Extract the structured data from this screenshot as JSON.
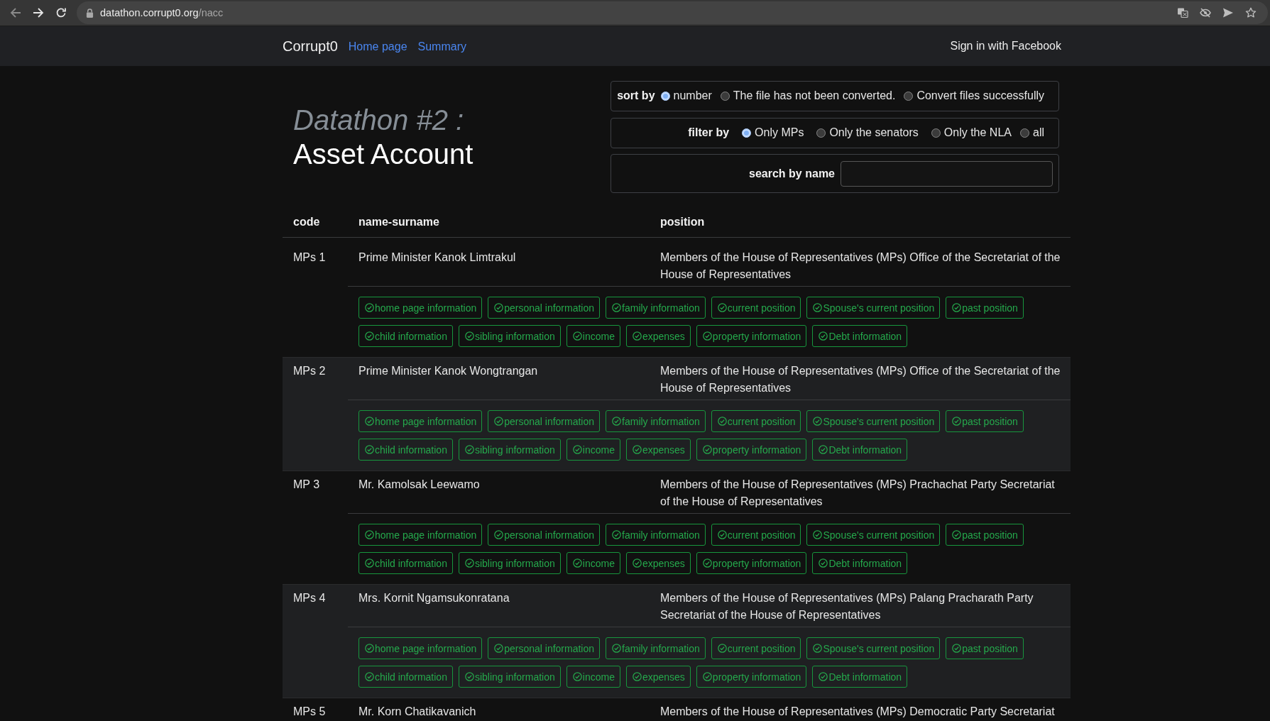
{
  "browser": {
    "back_enabled": false,
    "forward_enabled": true,
    "url_host": "datathon.corrupt0.org",
    "url_path": "/nacc"
  },
  "navbar": {
    "brand": "Corrupt0",
    "links": [
      "Home page",
      "Summary"
    ],
    "sign_in": "Sign in with Facebook"
  },
  "header": {
    "event": "Datathon #2 :",
    "title": "Asset Account"
  },
  "sort_by": {
    "label": "sort by",
    "options": [
      {
        "label": "number",
        "selected": true
      },
      {
        "label": "The file has not been converted.",
        "selected": false
      },
      {
        "label": "Convert files successfully",
        "selected": false
      }
    ]
  },
  "filter_by": {
    "label": "filter by",
    "options": [
      {
        "label": "Only MPs",
        "selected": true
      },
      {
        "label": "Only the senators",
        "selected": false
      },
      {
        "label": "Only the NLA",
        "selected": false
      },
      {
        "label": "all",
        "selected": false
      }
    ]
  },
  "search": {
    "label": "search by name"
  },
  "table": {
    "columns": [
      "code",
      "name-surname",
      "position"
    ],
    "rows": [
      {
        "code": "MPs 1",
        "name": "Prime Minister Kanok Limtrakul",
        "position": "Members of the House of Representatives (MPs) Office of the Secretariat of the House of Representatives",
        "tags": [
          {
            "label": "home page information",
            "checked": true
          },
          {
            "label": "personal information",
            "checked": true
          },
          {
            "label": "family information",
            "checked": true
          },
          {
            "label": "current position",
            "checked": true
          },
          {
            "label": "Spouse's current position",
            "checked": true
          },
          {
            "label": "past position",
            "checked": true
          },
          {
            "label": "child information",
            "checked": true
          },
          {
            "label": "sibling information",
            "checked": true
          },
          {
            "label": "income",
            "checked": true
          },
          {
            "label": "expenses",
            "checked": true
          },
          {
            "label": "property information",
            "checked": true
          },
          {
            "label": "Debt information",
            "checked": true
          }
        ]
      },
      {
        "code": "MPs 2",
        "name": "Prime Minister Kanok Wongtrangan",
        "position": "Members of the House of Representatives (MPs) Office of the Secretariat of the House of Representatives",
        "tags": [
          {
            "label": "home page information",
            "checked": true
          },
          {
            "label": "personal information",
            "checked": true
          },
          {
            "label": "family information",
            "checked": true
          },
          {
            "label": "current position",
            "checked": true
          },
          {
            "label": "Spouse's current position",
            "checked": true
          },
          {
            "label": "past position",
            "checked": true
          },
          {
            "label": "child information",
            "checked": true
          },
          {
            "label": "sibling information",
            "checked": true
          },
          {
            "label": "income",
            "checked": true
          },
          {
            "label": "expenses",
            "checked": true
          },
          {
            "label": "property information",
            "checked": true
          },
          {
            "label": "Debt information",
            "checked": true
          }
        ]
      },
      {
        "code": "MP 3",
        "name": "Mr. Kamolsak Leewamo",
        "position": "Members of the House of Representatives (MPs) Prachachat Party Secretariat of the House of Representatives",
        "tags": [
          {
            "label": "home page information",
            "checked": true
          },
          {
            "label": "personal information",
            "checked": true
          },
          {
            "label": "family information",
            "checked": true
          },
          {
            "label": "current position",
            "checked": true
          },
          {
            "label": "Spouse's current position",
            "checked": true
          },
          {
            "label": "past position",
            "checked": true
          },
          {
            "label": "child information",
            "checked": true
          },
          {
            "label": "sibling information",
            "checked": true
          },
          {
            "label": "income",
            "checked": true
          },
          {
            "label": "expenses",
            "checked": true
          },
          {
            "label": "property information",
            "checked": true
          },
          {
            "label": "Debt information",
            "checked": true
          }
        ]
      },
      {
        "code": "MPs 4",
        "name": "Mrs. Kornit Ngamsukonratana",
        "position": "Members of the House of Representatives (MPs) Palang Pracharath Party Secretariat of the House of Representatives",
        "tags": [
          {
            "label": "home page information",
            "checked": true
          },
          {
            "label": "personal information",
            "checked": true
          },
          {
            "label": "family information",
            "checked": true
          },
          {
            "label": "current position",
            "checked": true
          },
          {
            "label": "Spouse's current position",
            "checked": true
          },
          {
            "label": "past position",
            "checked": true
          },
          {
            "label": "child information",
            "checked": true
          },
          {
            "label": "sibling information",
            "checked": true
          },
          {
            "label": "income",
            "checked": true
          },
          {
            "label": "expenses",
            "checked": true
          },
          {
            "label": "property information",
            "checked": true
          },
          {
            "label": "Debt information",
            "checked": true
          }
        ]
      },
      {
        "code": "MPs 5",
        "name": "Mr. Korn Chatikavanich",
        "position": "Members of the House of Representatives (MPs) Democratic Party Secretariat"
      }
    ]
  }
}
